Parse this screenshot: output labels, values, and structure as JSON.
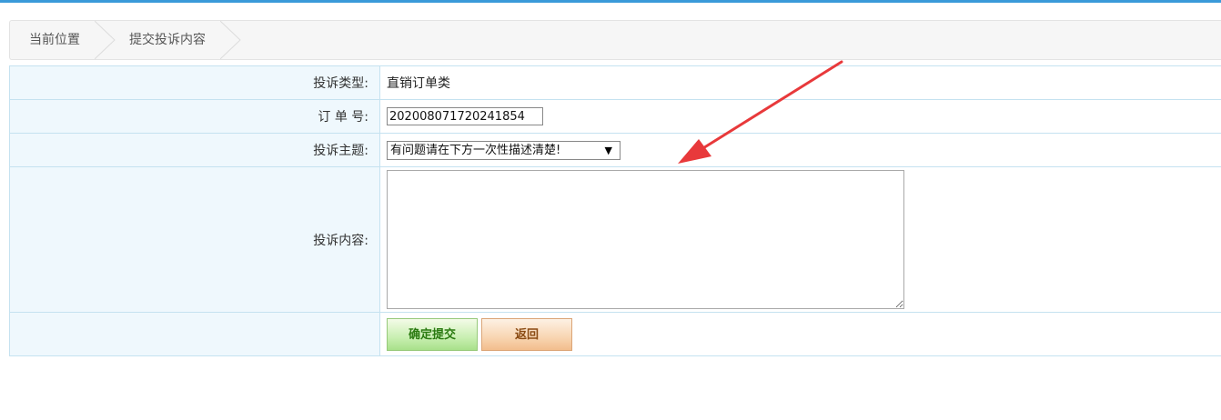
{
  "breadcrumb": {
    "items": [
      "当前位置",
      "提交投诉内容"
    ]
  },
  "form": {
    "type_label": "投诉类型:",
    "type_value": "直销订单类",
    "order_label": "订 单 号:",
    "order_value": "202008071720241854",
    "subject_label": "投诉主题:",
    "subject_selected": "有问题请在下方一次性描述清楚!",
    "content_label": "投诉内容:",
    "content_value": ""
  },
  "buttons": {
    "submit_label": "确定提交",
    "back_label": "返回"
  },
  "colors": {
    "accent": "#3a9ad9",
    "label_bg": "#eff8fd",
    "border": "#c5e2f0",
    "annotation_arrow": "#e8393b"
  }
}
